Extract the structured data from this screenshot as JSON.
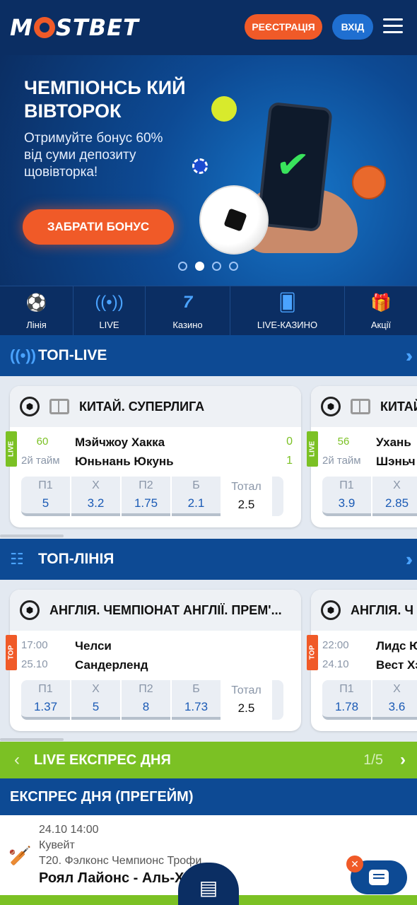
{
  "header": {
    "logo": "M{O}STBET",
    "logo_left": "M",
    "logo_right": "STBET",
    "register_label": "РЕЄСТРАЦІЯ",
    "login_label": "ВХІД"
  },
  "banner": {
    "title": "ЧЕМПІОНСЬ КИЙ ВІВТОРОК",
    "subtitle": "Отримуйте бонус 60% від суми депозиту щовівторка!",
    "cta_label": "ЗАБРАТИ БОНУС",
    "slides_total": 4,
    "active_slide": 2
  },
  "nav": {
    "items": [
      {
        "label": "Лінія",
        "icon": "soccer-icon"
      },
      {
        "label": "LIVE",
        "icon": "live-icon"
      },
      {
        "label": "Казино",
        "icon": "casino-7-icon"
      },
      {
        "label": "LIVE-КАЗИНО",
        "icon": "cards-icon"
      },
      {
        "label": "Акції",
        "icon": "gift-icon"
      }
    ]
  },
  "top_live": {
    "title": "ТОП-LIVE",
    "cards": [
      {
        "league": "КИТАЙ. СУПЕРЛИГА",
        "badge": "LIVE",
        "minute": "60",
        "period": "2й тайм",
        "team1": "Мэйчжоу Хакка",
        "team2": "Юньнань Юкунь",
        "score1": "0",
        "score2": "1",
        "odds": [
          {
            "k": "П1",
            "v": "5"
          },
          {
            "k": "Х",
            "v": "3.2"
          },
          {
            "k": "П2",
            "v": "1.75"
          },
          {
            "k": "Б",
            "v": "2.1"
          },
          {
            "k": "Тотал",
            "v": "2.5"
          }
        ]
      },
      {
        "league": "КИТАЙ",
        "badge": "LIVE",
        "minute": "56",
        "period": "2й тайм",
        "team1": "Ухань",
        "team2": "Шэньч",
        "score1": "",
        "score2": "",
        "odds": [
          {
            "k": "П1",
            "v": "3.9"
          },
          {
            "k": "Х",
            "v": "2.85"
          }
        ]
      }
    ]
  },
  "top_line": {
    "title": "ТОП-ЛІНІЯ",
    "cards": [
      {
        "league": "АНГЛІЯ. ЧЕМПІОНАТ АНГЛІЇ. ПРЕМ'...",
        "badge": "TOP",
        "time": "17:00",
        "date": "25.10",
        "team1": "Челси",
        "team2": "Сандерленд",
        "odds": [
          {
            "k": "П1",
            "v": "1.37"
          },
          {
            "k": "Х",
            "v": "5"
          },
          {
            "k": "П2",
            "v": "8"
          },
          {
            "k": "Б",
            "v": "1.73"
          },
          {
            "k": "Тотал",
            "v": "2.5"
          }
        ]
      },
      {
        "league": "АНГЛІЯ. Ч",
        "badge": "TOP",
        "time": "22:00",
        "date": "24.10",
        "team1": "Лидс Юн",
        "team2": "Вест Хэм",
        "odds": [
          {
            "k": "П1",
            "v": "1.78"
          },
          {
            "k": "Х",
            "v": "3.6"
          }
        ]
      }
    ]
  },
  "express_live": {
    "title": "LIVE ЕКСПРЕС ДНЯ",
    "counter": "1/5"
  },
  "express_pregame": {
    "title": "ЕКСПРЕС ДНЯ (ПРЕГЕЙМ)",
    "date": "24.10 14:00",
    "country": "Кувейт",
    "league": "T20. Фэлконс Чемпионс Трофи",
    "match": "Роял Лайонс - Аль-Х          ри XI"
  },
  "colors": {
    "brand_orange": "#f05a28",
    "navy": "#0b2e63",
    "section_blue": "#0d4a94",
    "live_green": "#7bc124",
    "odd_blue": "#1a5ab5"
  }
}
